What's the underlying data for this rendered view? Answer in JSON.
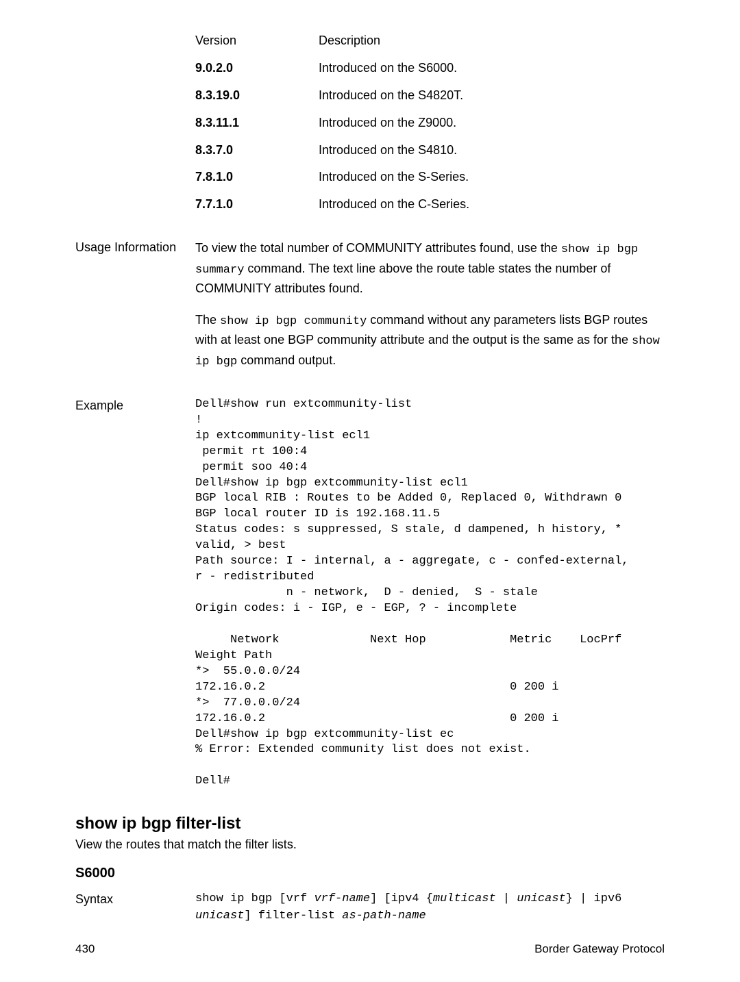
{
  "version_table": {
    "headers": {
      "version": "Version",
      "description": "Description"
    },
    "rows": [
      {
        "version": "9.0.2.0",
        "description": "Introduced on the S6000."
      },
      {
        "version": "8.3.19.0",
        "description": "Introduced on the S4820T."
      },
      {
        "version": "8.3.11.1",
        "description": "Introduced on the Z9000."
      },
      {
        "version": "8.3.7.0",
        "description": "Introduced on the S4810."
      },
      {
        "version": "7.8.1.0",
        "description": "Introduced on the S-Series."
      },
      {
        "version": "7.7.1.0",
        "description": "Introduced on the C-Series."
      }
    ]
  },
  "usage": {
    "label": "Usage Information",
    "para1_a": "To view the total number of COMMUNITY attributes found, use the ",
    "para1_code1": "show ip bgp summary",
    "para1_b": " command. The text line above the route table states the number of COMMUNITY attributes found.",
    "para2_a": "The ",
    "para2_code1": "show ip bgp community",
    "para2_b": " command without any parameters lists BGP routes with at least one BGP community attribute and the output is the same as for the ",
    "para2_code2": "show ip bgp",
    "para2_c": " command output."
  },
  "example": {
    "label": "Example",
    "block": "Dell#show run extcommunity-list\n!\nip extcommunity-list ecl1\n permit rt 100:4\n permit soo 40:4\nDell#show ip bgp extcommunity-list ecl1\nBGP local RIB : Routes to be Added 0, Replaced 0, Withdrawn 0\nBGP local router ID is 192.168.11.5\nStatus codes: s suppressed, S stale, d dampened, h history, *\nvalid, > best\nPath source: I - internal, a - aggregate, c - confed-external,\nr - redistributed\n             n - network,  D - denied,  S - stale\nOrigin codes: i - IGP, e - EGP, ? - incomplete\n\n     Network             Next Hop            Metric    LocPrf\nWeight Path\n*>  55.0.0.0/24\n172.16.0.2                                   0 200 i\n*>  77.0.0.0/24\n172.16.0.2                                   0 200 i\nDell#show ip bgp extcommunity-list ec\n% Error: Extended community list does not exist.\n\nDell#"
  },
  "command_section": {
    "heading": "show ip bgp filter-list",
    "description": "View the routes that match the filter lists.",
    "platform": "S6000"
  },
  "syntax": {
    "label": "Syntax",
    "t1": "show ip bgp ",
    "t2": "[vrf ",
    "i1": "vrf-name",
    "t3": "] [ipv4 {",
    "i2": "multicast",
    "t4": " | ",
    "i3": "unicast",
    "t5": "} | ipv6 ",
    "i4": "unicast",
    "t6": "] filter-list ",
    "i5": "as-path-name"
  },
  "footer": {
    "page": "430",
    "chapter": "Border Gateway Protocol"
  }
}
